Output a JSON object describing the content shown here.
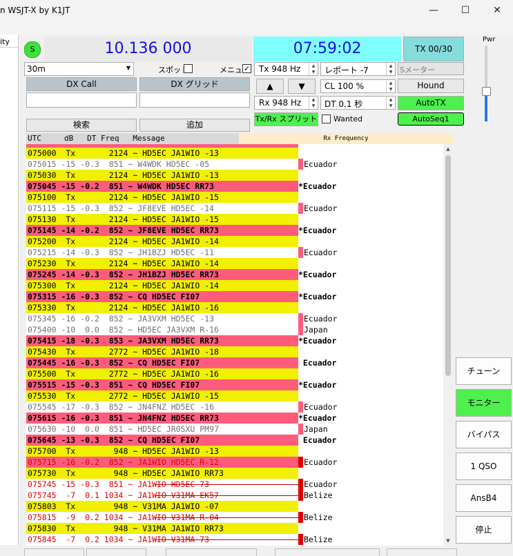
{
  "window": {
    "title": "n WSJT-X  by K1JT",
    "minimize": "—",
    "maximize": "☐",
    "close": "✕"
  },
  "left_panel_label": "ity",
  "status_button": "S",
  "dial_frequency": "10.136 000",
  "utc_time": "07:59:02",
  "tx_status": "TX 00/30",
  "power_label": "Pwr",
  "power_level": 0.4,
  "band": {
    "value": "30m"
  },
  "spot": {
    "label": "スポット",
    "checked": false
  },
  "menu": {
    "label": "メニュー",
    "checked": true
  },
  "tx_freq": "Tx  948  Hz",
  "rx_freq": "Rx  948  Hz",
  "report": "レポート -7",
  "s_meter": "Sメーター",
  "cl": "CL  100 %",
  "dt": "DT 0.1 秒",
  "hound": "Hound",
  "auto_tx": "AutoTX",
  "auto_seq": "AutoSeq1",
  "split": "Tx/Rx スプリット",
  "wanted": {
    "label": "Wanted",
    "checked": false
  },
  "dx_call": {
    "label": "DX Call",
    "value": ""
  },
  "dx_grid": {
    "label": "DX グリッド",
    "value": ""
  },
  "search_button": "検索",
  "add_button": "追加",
  "up_arrow": "▲",
  "down_arrow": "▼",
  "table_header": "UTC     dB   DT Freq   Message",
  "rx_frequency_header": "Rx Frequency",
  "rows": [
    {
      "text": "075000  Tx       2124 ~ HD5EC JA1WIO -13",
      "style": "tx",
      "country": "",
      "marker": ""
    },
    {
      "text": "075015 -15 -0.3  851 ~ W4WDK HD5EC -05",
      "style": "gray",
      "country": "Ecuador",
      "marker": "pink"
    },
    {
      "text": "075030  Tx       2124 ~ HD5EC JA1WIO -13",
      "style": "tx",
      "country": "",
      "marker": ""
    },
    {
      "text": "075045 -15 -0.2  851 ~ W4WDK HD5EC RR73",
      "style": "hit",
      "country": "*Ecuador",
      "marker": ""
    },
    {
      "text": "075100  Tx       2124 ~ HD5EC JA1WIO -15",
      "style": "tx",
      "country": "",
      "marker": ""
    },
    {
      "text": "075115 -15 -0.3  852 ~ JF8EVE HD5EC -14",
      "style": "gray",
      "country": "Ecuador",
      "marker": "pink"
    },
    {
      "text": "075130  Tx       2124 ~ HD5EC JA1WIO -15",
      "style": "tx",
      "country": "",
      "marker": ""
    },
    {
      "text": "075145 -14 -0.2  852 ~ JF8EVE HD5EC RR73",
      "style": "hit",
      "country": "*Ecuador",
      "marker": ""
    },
    {
      "text": "075200  Tx       2124 ~ HD5EC JA1WIO -14",
      "style": "tx",
      "country": "",
      "marker": ""
    },
    {
      "text": "075215 -14 -0.3  852 ~ JH1BZJ HD5EC -11",
      "style": "gray",
      "country": "Ecuador",
      "marker": "pink"
    },
    {
      "text": "075230  Tx       2124 ~ HD5EC JA1WIO -14",
      "style": "tx",
      "country": "",
      "marker": ""
    },
    {
      "text": "075245 -14 -0.3  852 ~ JH1BZJ HD5EC RR73",
      "style": "hit",
      "country": "*Ecuador",
      "marker": ""
    },
    {
      "text": "075300  Tx       2124 ~ HD5EC JA1WIO -14",
      "style": "tx",
      "country": "",
      "marker": ""
    },
    {
      "text": "075315 -16 -0.3  852 ~ CQ HD5EC FI07",
      "style": "hit",
      "country": "*Ecuador",
      "marker": ""
    },
    {
      "text": "075330  Tx       2124 ~ HD5EC JA1WIO -16",
      "style": "tx",
      "country": "",
      "marker": ""
    },
    {
      "text": "075345 -16 -0.2  852 ~ JA3VXM HD5EC -13",
      "style": "gray",
      "country": "Ecuador",
      "marker": "pink"
    },
    {
      "text": "075400 -10  0.0  852 ~ HD5EC JA3VXM R-16",
      "style": "gray",
      "country": "Japan",
      "marker": "pink"
    },
    {
      "text": "075415 -18 -0.3  853 ~ JA3VXM HD5EC RR73",
      "style": "hit",
      "country": "*Ecuador",
      "marker": ""
    },
    {
      "text": "075430  Tx       2772 ~ HD5EC JA1WIO -18",
      "style": "tx",
      "country": "",
      "marker": ""
    },
    {
      "text": "075445 -16 -0.3  852 ~ CQ HD5EC FI07",
      "style": "hit",
      "country": " Ecuador",
      "marker": ""
    },
    {
      "text": "075500  Tx       2772 ~ HD5EC JA1WIO -16",
      "style": "tx",
      "country": "",
      "marker": ""
    },
    {
      "text": "075515 -15 -0.3  851 ~ CQ HD5EC FI07",
      "style": "hit",
      "country": "*Ecuador",
      "marker": ""
    },
    {
      "text": "075530  Tx       2772 ~ HD5EC JA1WIO -15",
      "style": "tx",
      "country": "",
      "marker": ""
    },
    {
      "text": "075545 -17 -0.3  852 ~ JN4FNZ HD5EC -16",
      "style": "gray",
      "country": "Ecuador",
      "marker": "pink"
    },
    {
      "text": "075615 -16 -0.3  851 ~ JN4FNZ HD5EC RR73",
      "style": "hit",
      "country": "*Ecuador",
      "marker": ""
    },
    {
      "text": "075630 -10  0.0  851 ~ HD5EC JR0SXU PM97",
      "style": "gray",
      "country": "Japan",
      "marker": "pink"
    },
    {
      "text": "075645 -13 -0.3  852 ~ CQ HD5EC FI07",
      "style": "hit",
      "country": " Ecuador",
      "marker": ""
    },
    {
      "text": "075700  Tx        948 ~ HD5EC JA1WIO -13",
      "style": "tx",
      "country": "",
      "marker": ""
    },
    {
      "text": "075715 -16 -0.2  852 ~ JA1WIO HD5EC R-12",
      "style": "mine",
      "country": "Ecuador",
      "marker": "red"
    },
    {
      "text": "075730  Tx        948 ~ HD5EC JA1WIO RR73",
      "style": "tx",
      "country": "",
      "marker": ""
    },
    {
      "text": "075745 -15 -0.3  851 ~ JA1WIO HD5EC 73",
      "style": "struck",
      "country": "Ecuador",
      "marker": "red"
    },
    {
      "text": "075745  -7  0.1 1034 ~ JA1WIO V31MA EK57",
      "style": "struck",
      "country": "Belize",
      "marker": "red"
    },
    {
      "text": "075803  Tx        948 ~ V31MA JA1WIO -07",
      "style": "tx",
      "country": "",
      "marker": ""
    },
    {
      "text": "075815  -9  0.2 1034 ~ JA1WIO V31MA R-04",
      "style": "struck",
      "country": "Belize",
      "marker": "red"
    },
    {
      "text": "075830  Tx        948 ~ V31MA JA1WIO RR73",
      "style": "tx",
      "country": "",
      "marker": ""
    },
    {
      "text": "075845  -7  0.2 1034 ~ JA1WIO V31MA 73",
      "style": "struck",
      "country": "Belize",
      "marker": "red"
    }
  ],
  "right_buttons": [
    {
      "label": "チューン",
      "active": false
    },
    {
      "label": "モニター",
      "active": true
    },
    {
      "label": "バイパス",
      "active": false
    },
    {
      "label": "1 QSO",
      "active": false
    },
    {
      "label": "AnsB4",
      "active": false
    },
    {
      "label": "停止",
      "active": false
    }
  ],
  "colors": {
    "tx_row": "#f0f000",
    "hit_row": "#ff5c7c",
    "green": "#4ef04e",
    "cyan": "#80ffff",
    "blue_text": "#1010e0"
  }
}
